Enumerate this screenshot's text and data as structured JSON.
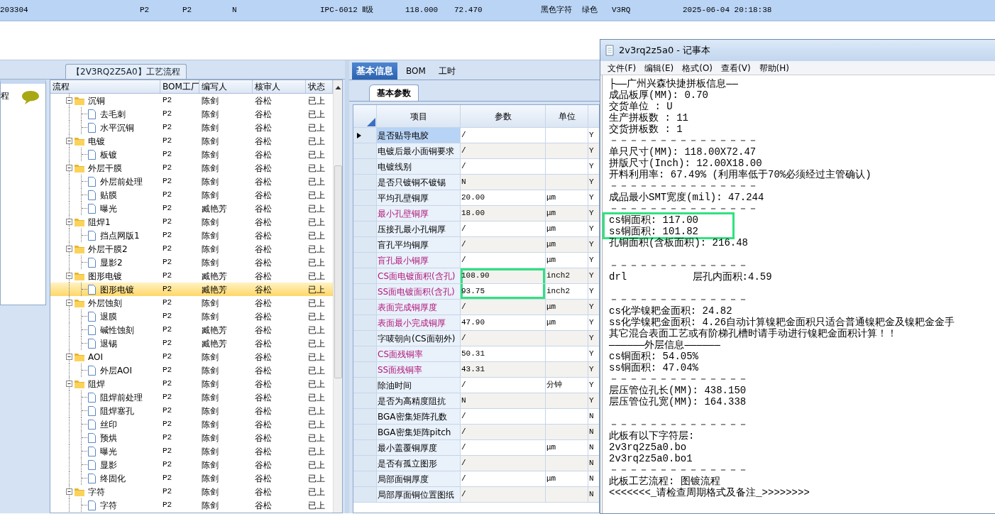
{
  "top_row": {
    "selected": true,
    "cells": [
      "203304",
      "P2",
      "P2",
      "N",
      "IPC-6012 Ⅱ级",
      "118.000",
      "72.470",
      "黑色字符",
      "绿色",
      "V3RQ",
      "2025-06-04 20:18:38"
    ]
  },
  "left_strip": {
    "label": "程"
  },
  "flow_panel": {
    "title": "【2V3RQ2Z5A0】工艺流程",
    "columns": [
      "流程",
      "BOM工厂",
      "编写人",
      "核审人",
      "状态"
    ],
    "rows": [
      {
        "name": "沉铜",
        "bom": "P2",
        "writer": "陈剑",
        "reviewer": "谷松",
        "status": "已上",
        "expanded": true,
        "selected": false,
        "children": [
          {
            "name": "去毛刺",
            "bom": "P2",
            "writer": "陈剑",
            "reviewer": "谷松",
            "status": "已上",
            "selected": false
          },
          {
            "name": "水平沉铜",
            "bom": "P2",
            "writer": "陈剑",
            "reviewer": "谷松",
            "status": "已上",
            "selected": false
          }
        ]
      },
      {
        "name": "电镀",
        "bom": "P2",
        "writer": "陈剑",
        "reviewer": "谷松",
        "status": "已上",
        "expanded": true,
        "selected": false,
        "children": [
          {
            "name": "板镀",
            "bom": "P2",
            "writer": "陈剑",
            "reviewer": "谷松",
            "status": "已上",
            "selected": false
          }
        ]
      },
      {
        "name": "外层干膜",
        "bom": "P2",
        "writer": "陈剑",
        "reviewer": "谷松",
        "status": "已上",
        "expanded": true,
        "selected": false,
        "children": [
          {
            "name": "外层前处理",
            "bom": "P2",
            "writer": "陈剑",
            "reviewer": "谷松",
            "status": "已上",
            "selected": false
          },
          {
            "name": "贴膜",
            "bom": "P2",
            "writer": "陈剑",
            "reviewer": "谷松",
            "status": "已上",
            "selected": false
          },
          {
            "name": "曝光",
            "bom": "P2",
            "writer": "臧艳芳",
            "reviewer": "谷松",
            "status": "已上",
            "selected": false
          }
        ]
      },
      {
        "name": "阻焊1",
        "bom": "P2",
        "writer": "陈剑",
        "reviewer": "谷松",
        "status": "已上",
        "expanded": true,
        "selected": false,
        "children": [
          {
            "name": "挡点网版1",
            "bom": "P2",
            "writer": "陈剑",
            "reviewer": "谷松",
            "status": "已上",
            "selected": false
          }
        ]
      },
      {
        "name": "外层干膜2",
        "bom": "P2",
        "writer": "陈剑",
        "reviewer": "谷松",
        "status": "已上",
        "expanded": true,
        "selected": false,
        "children": [
          {
            "name": "显影2",
            "bom": "P2",
            "writer": "陈剑",
            "reviewer": "谷松",
            "status": "已上",
            "selected": false
          }
        ]
      },
      {
        "name": "图形电镀",
        "bom": "P2",
        "writer": "臧艳芳",
        "reviewer": "谷松",
        "status": "已上",
        "expanded": true,
        "selected": false,
        "children": [
          {
            "name": "图形电镀",
            "bom": "P2",
            "writer": "臧艳芳",
            "reviewer": "谷松",
            "status": "已上",
            "selected": true
          }
        ]
      },
      {
        "name": "外层蚀刻",
        "bom": "P2",
        "writer": "陈剑",
        "reviewer": "谷松",
        "status": "已上",
        "expanded": true,
        "selected": false,
        "children": [
          {
            "name": "退膜",
            "bom": "P2",
            "writer": "陈剑",
            "reviewer": "谷松",
            "status": "已上",
            "selected": false
          },
          {
            "name": "碱性蚀刻",
            "bom": "P2",
            "writer": "臧艳芳",
            "reviewer": "谷松",
            "status": "已上",
            "selected": false
          },
          {
            "name": "退锡",
            "bom": "P2",
            "writer": "臧艳芳",
            "reviewer": "谷松",
            "status": "已上",
            "selected": false
          }
        ]
      },
      {
        "name": "AOI",
        "bom": "P2",
        "writer": "陈剑",
        "reviewer": "谷松",
        "status": "已上",
        "expanded": true,
        "selected": false,
        "children": [
          {
            "name": "外层AOI",
            "bom": "P2",
            "writer": "陈剑",
            "reviewer": "谷松",
            "status": "已上",
            "selected": false
          }
        ]
      },
      {
        "name": "阻焊",
        "bom": "P2",
        "writer": "陈剑",
        "reviewer": "谷松",
        "status": "已上",
        "expanded": true,
        "selected": false,
        "children": [
          {
            "name": "阻焊前处理",
            "bom": "P2",
            "writer": "陈剑",
            "reviewer": "谷松",
            "status": "已上",
            "selected": false
          },
          {
            "name": "阻焊塞孔",
            "bom": "P2",
            "writer": "陈剑",
            "reviewer": "谷松",
            "status": "已上",
            "selected": false
          },
          {
            "name": "丝印",
            "bom": "P2",
            "writer": "陈剑",
            "reviewer": "谷松",
            "status": "已上",
            "selected": false
          },
          {
            "name": "预烘",
            "bom": "P2",
            "writer": "陈剑",
            "reviewer": "谷松",
            "status": "已上",
            "selected": false
          },
          {
            "name": "曝光",
            "bom": "P2",
            "writer": "陈剑",
            "reviewer": "谷松",
            "status": "已上",
            "selected": false
          },
          {
            "name": "显影",
            "bom": "P2",
            "writer": "陈剑",
            "reviewer": "谷松",
            "status": "已上",
            "selected": false
          },
          {
            "name": "终固化",
            "bom": "P2",
            "writer": "陈剑",
            "reviewer": "谷松",
            "status": "已上",
            "selected": false
          }
        ]
      },
      {
        "name": "字符",
        "bom": "P2",
        "writer": "陈剑",
        "reviewer": "谷松",
        "status": "已上",
        "expanded": true,
        "selected": false,
        "children": [
          {
            "name": "字符",
            "bom": "P2",
            "writer": "陈剑",
            "reviewer": "谷松",
            "status": "已上",
            "selected": false
          }
        ]
      }
    ]
  },
  "detail_panel": {
    "tabs": [
      {
        "label": "基本信息",
        "selected": true
      },
      {
        "label": "BOM",
        "selected": false
      },
      {
        "label": "工时",
        "selected": false
      }
    ],
    "subtabs": [
      {
        "label": "基本参数",
        "selected": true
      }
    ],
    "columns": [
      "项目",
      "参数",
      "单位"
    ],
    "rows": [
      {
        "name": "是否贴导电胶",
        "value": "/",
        "flag": "Y",
        "emphasis": false,
        "selected": true,
        "highlighted": false
      },
      {
        "name": "电镀后最小面铜要求",
        "value": "/",
        "flag": "Y",
        "emphasis": false,
        "selected": false,
        "highlighted": false
      },
      {
        "name": "电镀线别",
        "value": "/",
        "flag": "Y",
        "emphasis": false,
        "selected": false,
        "highlighted": false
      },
      {
        "name": "是否只镀铜不镀锡",
        "value": "N",
        "flag": "Y",
        "emphasis": false,
        "selected": false,
        "highlighted": false
      },
      {
        "name": "平均孔壁铜厚",
        "value": "20.00",
        "unit": "μm",
        "flag": "Y",
        "emphasis": false,
        "selected": false,
        "highlighted": false
      },
      {
        "name": "最小孔壁铜厚",
        "value": "18.00",
        "unit": "μm",
        "flag": "Y",
        "emphasis": true,
        "selected": false,
        "highlighted": false
      },
      {
        "name": "压接孔最小孔铜厚",
        "value": "/",
        "unit": "μm",
        "flag": "Y",
        "emphasis": false,
        "selected": false,
        "highlighted": false
      },
      {
        "name": "盲孔平均铜厚",
        "value": "/",
        "unit": "μm",
        "flag": "Y",
        "emphasis": false,
        "selected": false,
        "highlighted": false
      },
      {
        "name": "盲孔最小铜厚",
        "value": "/",
        "unit": "μm",
        "flag": "Y",
        "emphasis": true,
        "selected": false,
        "highlighted": false
      },
      {
        "name": "CS面电镀面积(含孔)",
        "value": "108.90",
        "unit": "inch2",
        "flag": "Y",
        "emphasis": true,
        "selected": false,
        "highlighted": true
      },
      {
        "name": "SS面电镀面积(含孔)",
        "value": "93.75",
        "unit": "inch2",
        "flag": "Y",
        "emphasis": true,
        "selected": false,
        "highlighted": true
      },
      {
        "name": "表面完成铜厚度",
        "value": "/",
        "unit": "μm",
        "flag": "Y",
        "emphasis": true,
        "selected": false,
        "highlighted": false
      },
      {
        "name": "表面最小完成铜厚",
        "value": "47.90",
        "unit": "μm",
        "flag": "Y",
        "emphasis": true,
        "selected": false,
        "highlighted": false
      },
      {
        "name": "字唛朝向(CS面朝外)",
        "value": "/",
        "flag": "Y",
        "emphasis": false,
        "selected": false,
        "highlighted": false
      },
      {
        "name": "CS面残铜率",
        "value": "50.31",
        "flag": "Y",
        "emphasis": true,
        "selected": false,
        "highlighted": false
      },
      {
        "name": "SS面残铜率",
        "value": "43.31",
        "flag": "Y",
        "emphasis": true,
        "selected": false,
        "highlighted": false
      },
      {
        "name": "除油时间",
        "value": "/",
        "unit": "分钟",
        "flag": "Y",
        "emphasis": false,
        "selected": false,
        "highlighted": false
      },
      {
        "name": "是否为高精度阻抗",
        "value": "N",
        "flag": "Y",
        "emphasis": false,
        "selected": false,
        "highlighted": false
      },
      {
        "name": "BGA密集矩阵孔数",
        "value": "/",
        "flag": "N",
        "emphasis": false,
        "selected": false,
        "highlighted": false
      },
      {
        "name": "BGA密集矩阵pitch",
        "value": "/",
        "flag": "N",
        "emphasis": false,
        "selected": false,
        "highlighted": false
      },
      {
        "name": "最小盖覆铜厚度",
        "value": "/",
        "unit": "μm",
        "flag": "N",
        "emphasis": false,
        "selected": false,
        "highlighted": false
      },
      {
        "name": "是否有孤立图形",
        "value": "/",
        "flag": "N",
        "emphasis": false,
        "selected": false,
        "highlighted": false
      },
      {
        "name": "局部面铜厚度",
        "value": "/",
        "unit": "μm",
        "flag": "N",
        "emphasis": false,
        "selected": false,
        "highlighted": false
      },
      {
        "name": "局部厚面铜位置图纸",
        "value": "/",
        "flag": "N",
        "emphasis": false,
        "selected": false,
        "highlighted": false
      }
    ]
  },
  "notepad": {
    "title": "2v3rq2z5a0 - 记事本",
    "menu": [
      "文件(F)",
      "编辑(E)",
      "格式(O)",
      "查看(V)",
      "帮助(H)"
    ],
    "lines": [
      {
        "text": "├——广州兴森快捷拼板信息——",
        "blank_before": false,
        "highlighted": false
      },
      {
        "text": "成品板厚(MM): 0.70",
        "blank_before": false,
        "highlighted": false
      },
      {
        "text": "交货单位 : U",
        "blank_before": false,
        "highlighted": false
      },
      {
        "text": "生产拼板数 : 11",
        "blank_before": false,
        "highlighted": false
      },
      {
        "text": "交货拼板数 : 1",
        "blank_before": false,
        "highlighted": false
      },
      {
        "text": "－－－－－－－－－－－－－－－",
        "blank_before": false,
        "highlighted": false
      },
      {
        "text": "单只尺寸(MM): 118.00X72.47",
        "blank_before": false,
        "highlighted": false
      },
      {
        "text": "拼版尺寸(Inch): 12.00X18.00",
        "blank_before": false,
        "highlighted": false
      },
      {
        "text": "开料利用率: 67.49% (利用率低于70%必须经过主管确认)",
        "blank_before": false,
        "highlighted": false
      },
      {
        "text": "－－－－－－－－－－－－－－－",
        "blank_before": false,
        "highlighted": false
      },
      {
        "text": "成品最小SMT宽度(mil): 47.244",
        "blank_before": false,
        "highlighted": false
      },
      {
        "text": "－－－－－－－－－－－－－－－",
        "blank_before": false,
        "highlighted": false
      },
      {
        "text": "cs铜面积: 117.00",
        "blank_before": false,
        "highlighted": true
      },
      {
        "text": "ss铜面积: 101.82",
        "blank_before": false,
        "highlighted": true
      },
      {
        "text": "孔铜面积(含板面积): 216.48",
        "blank_before": false,
        "highlighted": false
      },
      {
        "text": "－－－－－－－－－－－－－－",
        "blank_before": true,
        "highlighted": false
      },
      {
        "text": "drl           层孔内面积:4.59",
        "blank_before": false,
        "highlighted": false
      },
      {
        "text": "－－－－－－－－－－－－－－",
        "blank_before": true,
        "highlighted": false
      },
      {
        "text": "cs化学镍耙金面积: 24.82",
        "blank_before": false,
        "highlighted": false
      },
      {
        "text": "ss化学镍耙金面积: 4.26自动计算镍耙金面积只适合普通镍耙金及镍耙金金手",
        "blank_before": false,
        "highlighted": false
      },
      {
        "text": "其它混合表面工艺或有阶梯孔槽时请手动进行镍耙金面积计算！！",
        "blank_before": false,
        "highlighted": false
      },
      {
        "text": "——————外层信息——————",
        "blank_before": false,
        "highlighted": false
      },
      {
        "text": "cs铜面积: 54.05%",
        "blank_before": false,
        "highlighted": false
      },
      {
        "text": "ss铜面积: 47.04%",
        "blank_before": false,
        "highlighted": false
      },
      {
        "text": "－－－－－－－－－－－－－－",
        "blank_before": false,
        "highlighted": false
      },
      {
        "text": "层压管位孔长(MM): 438.150",
        "blank_before": false,
        "highlighted": false
      },
      {
        "text": "层压管位孔宽(MM): 164.338",
        "blank_before": false,
        "highlighted": false
      },
      {
        "text": "－－－－－－－－－－－－－－",
        "blank_before": true,
        "highlighted": false
      },
      {
        "text": "此板有以下字符层:",
        "blank_before": false,
        "highlighted": false
      },
      {
        "text": "2v3rq2z5a0.bo",
        "blank_before": false,
        "highlighted": false
      },
      {
        "text": "2v3rq2z5a0.bo1",
        "blank_before": false,
        "highlighted": false
      },
      {
        "text": "－－－－－－－－－－－－－－",
        "blank_before": false,
        "highlighted": false
      },
      {
        "text": "此板工艺流程: 图镀流程",
        "blank_before": false,
        "highlighted": false
      },
      {
        "text": "<<<<<<<_请检查周期格式及备注_>>>>>>>>",
        "blank_before": false,
        "highlighted": false
      }
    ]
  }
}
